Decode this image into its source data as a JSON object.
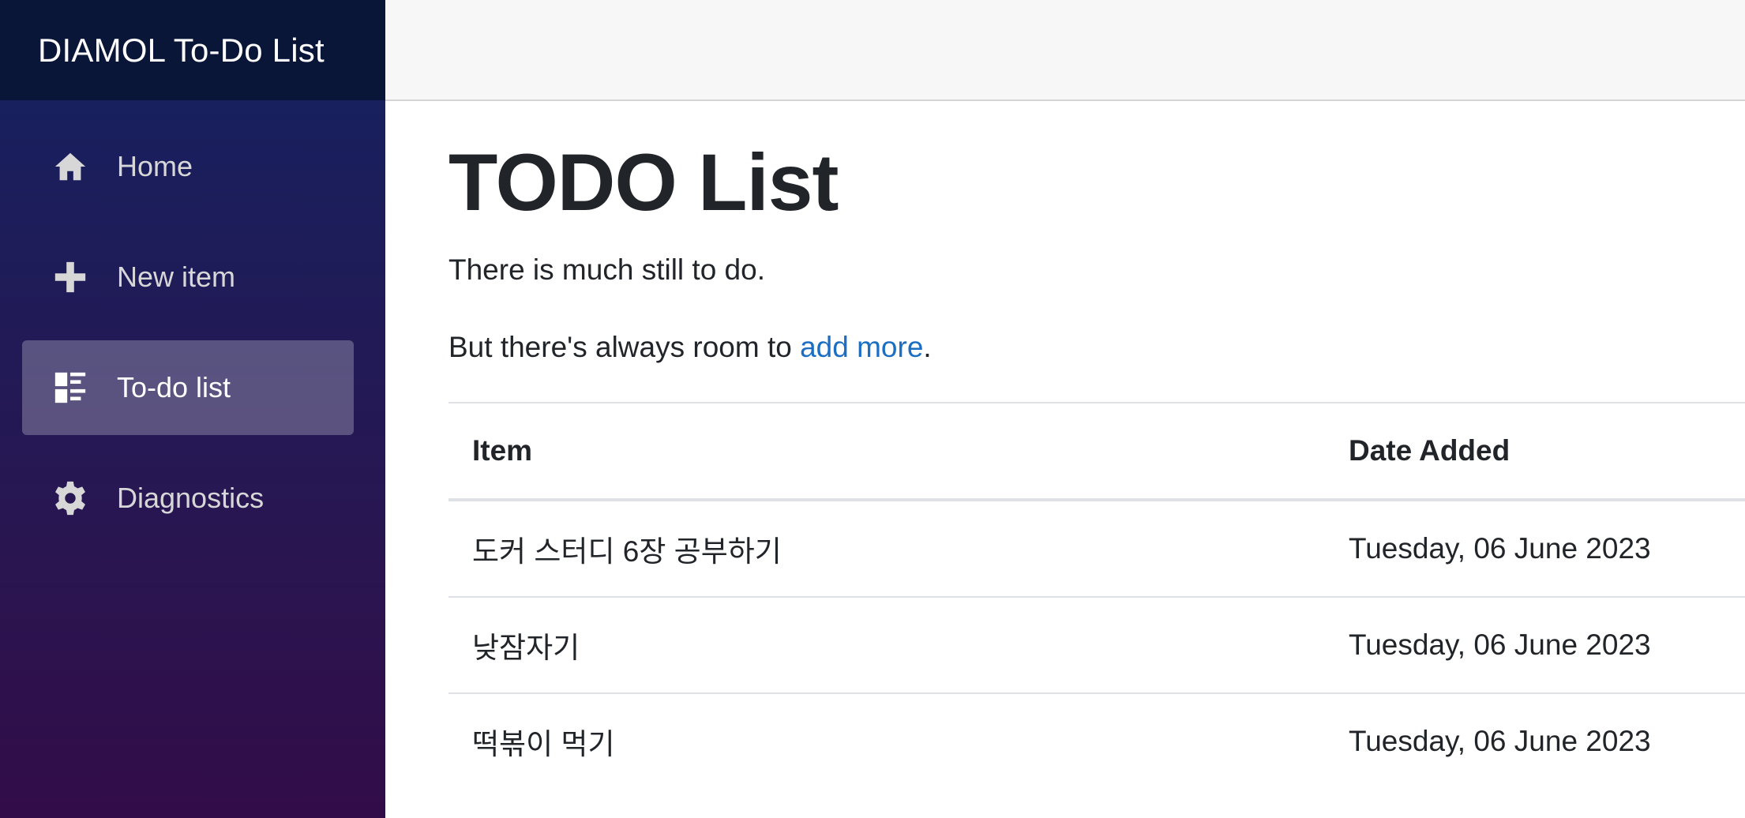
{
  "app": {
    "brand": "DIAMOL To-Do List"
  },
  "sidebar": {
    "items": [
      {
        "label": "Home",
        "icon": "home-icon",
        "active": false
      },
      {
        "label": "New item",
        "icon": "plus-icon",
        "active": false
      },
      {
        "label": "To-do list",
        "icon": "list-icon",
        "active": true
      },
      {
        "label": "Diagnostics",
        "icon": "gear-icon",
        "active": false
      }
    ]
  },
  "main": {
    "title": "TODO List",
    "lead": "There is much still to do.",
    "second_prefix": "But there's always room to ",
    "second_link": "add more",
    "second_suffix": ".",
    "table": {
      "headers": [
        "Item",
        "Date Added"
      ],
      "rows": [
        [
          "도커 스터디 6장 공부하기",
          "Tuesday, 06 June 2023"
        ],
        [
          "낮잠자기",
          "Tuesday, 06 June 2023"
        ],
        [
          "떡볶이 먹기",
          "Tuesday, 06 June 2023"
        ]
      ]
    }
  },
  "colors": {
    "sidebar_top": "#142260",
    "sidebar_bottom": "#320c48",
    "brand_bar": "#0a1638",
    "link": "#1b6ec2"
  }
}
